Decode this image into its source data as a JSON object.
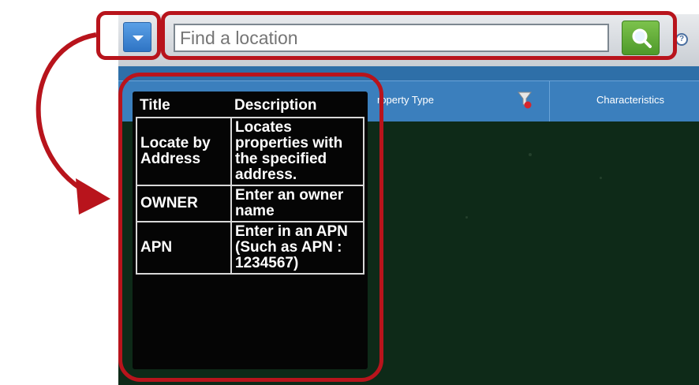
{
  "search": {
    "placeholder": "Find a location"
  },
  "grid": {
    "columns": [
      "roperty Type",
      "Characteristics"
    ]
  },
  "tooltip": {
    "headers": {
      "title": "Title",
      "description": "Description"
    },
    "rows": [
      {
        "title": "Locate by Address",
        "description": "Locates properties with the specified address."
      },
      {
        "title": "OWNER",
        "description": "Enter an owner name"
      },
      {
        "title": "APN",
        "description": "Enter in an APN (Such as APN : 1234567)"
      }
    ]
  },
  "colors": {
    "callout": "#b8141c",
    "header_blue": "#3b7fbd",
    "search_green": "#5aa832",
    "dropdown_blue": "#3a86d6",
    "map_dark": "#0e2a18"
  },
  "icons": [
    "chevron-down-icon",
    "magnifier-icon",
    "help-icon",
    "filter-remove-icon",
    "curved-arrow-icon"
  ]
}
